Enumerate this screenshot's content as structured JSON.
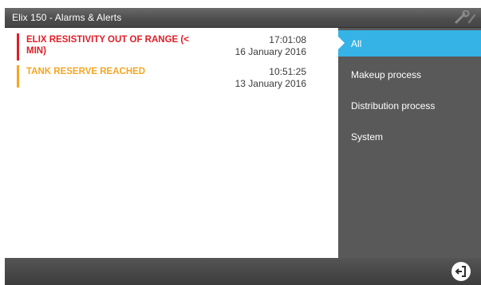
{
  "window": {
    "title": "Elix 150 - Alarms & Alerts",
    "tool_icon": "wrench-icon"
  },
  "alarms": [
    {
      "message": "ELIX RESISTIVITY OUT OF RANGE (< MIN)",
      "time": "17:01:08",
      "date": "16 January 2016",
      "severity": "alarm",
      "color": "#e01d26"
    },
    {
      "message": "TANK RESERVE REACHED",
      "time": "10:51:25",
      "date": "13 January 2016",
      "severity": "alert",
      "color": "#f5a623"
    }
  ],
  "menu": {
    "items": [
      {
        "label": "All",
        "active": true
      },
      {
        "label": "Makeup process",
        "active": false
      },
      {
        "label": "Distribution process",
        "active": false
      },
      {
        "label": "System",
        "active": false
      }
    ],
    "accent_color": "#35b3e6"
  },
  "bottom_bar": {
    "exit_icon": "exit-icon"
  }
}
